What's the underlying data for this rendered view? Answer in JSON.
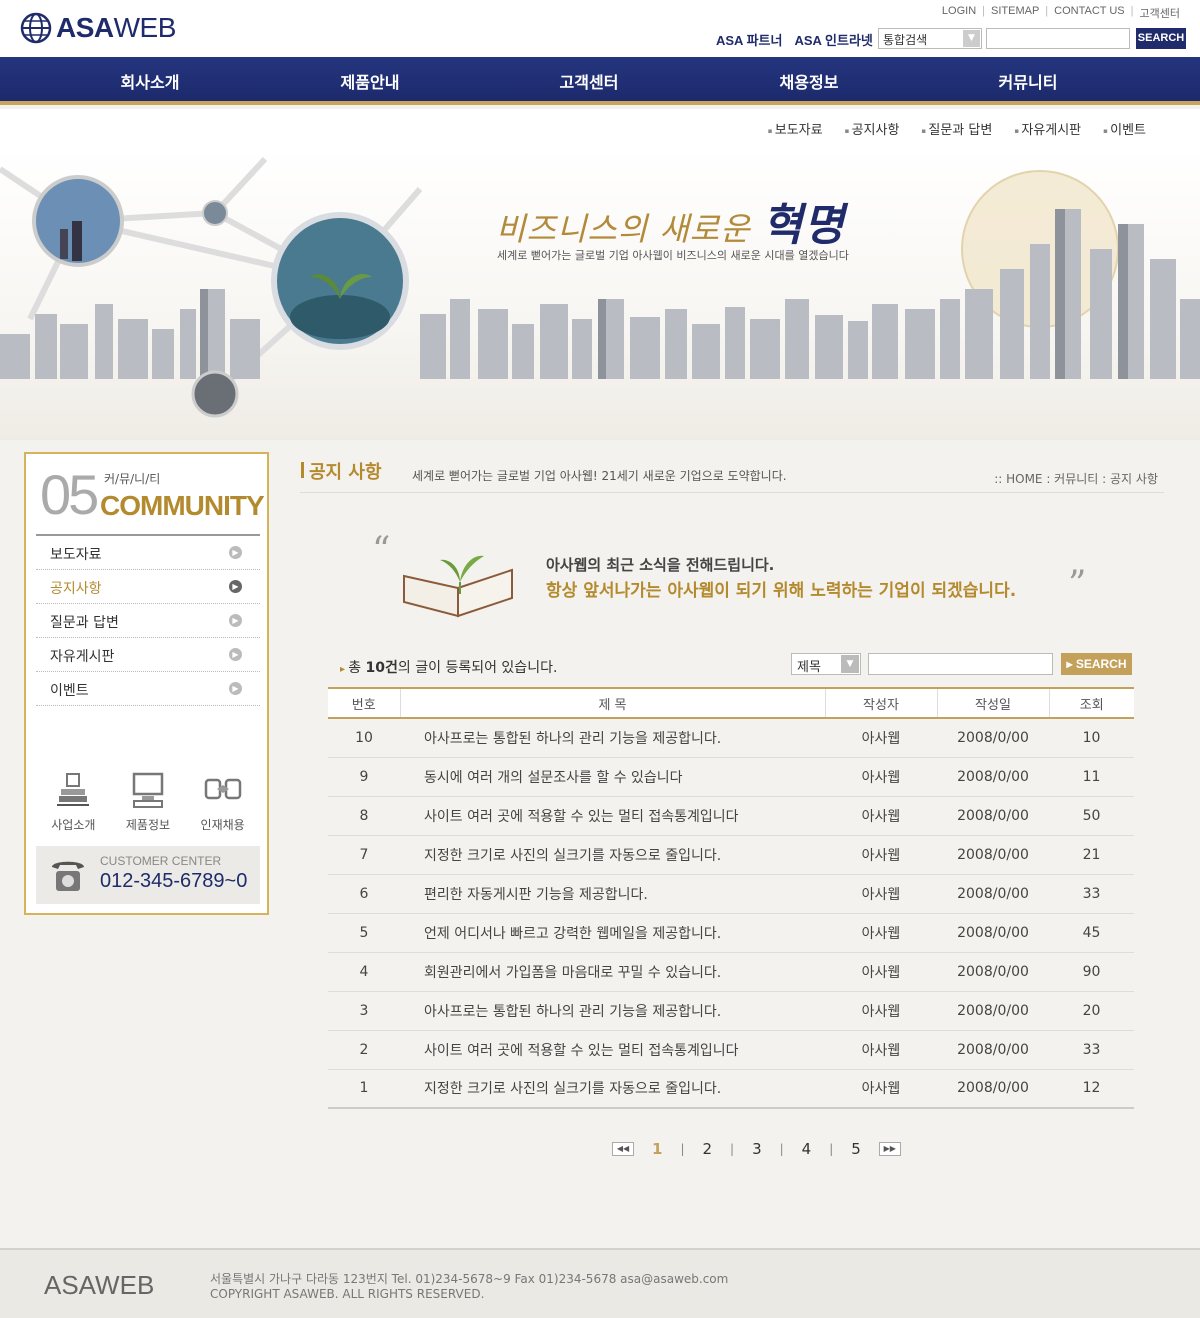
{
  "header": {
    "logo": {
      "bold": "ASA",
      "light": "WEB"
    },
    "toplinks": [
      "LOGIN",
      "SITEMAP",
      "CONTACT US",
      "고객센터"
    ],
    "partners": [
      "ASA 파트너",
      "ASA 인트라넷"
    ],
    "search_scope": "통합검색",
    "search_button": "SEARCH"
  },
  "nav": [
    "회사소개",
    "제품안내",
    "고객센터",
    "채용정보",
    "커뮤니티"
  ],
  "subnav": [
    "보도자료",
    "공지사항",
    "질문과 답변",
    "자유게시판",
    "이벤트"
  ],
  "banner": {
    "title": "비즈니스의 새로운",
    "title_emph": "혁명",
    "subtitle": "세계로 뻗어가는 글로벌 기업 아사웹이 비즈니스의 새로운 시대를 열겠습니다"
  },
  "sidebar": {
    "number": "05",
    "kor": "커/뮤/니/티",
    "eng": "COMMUNITY",
    "menu": [
      {
        "label": "보도자료",
        "active": false
      },
      {
        "label": "공지사항",
        "active": true
      },
      {
        "label": "질문과 답변",
        "active": false
      },
      {
        "label": "자유게시판",
        "active": false
      },
      {
        "label": "이벤트",
        "active": false
      }
    ],
    "quick": [
      "사업소개",
      "제품정보",
      "인재채용"
    ],
    "customer_center": {
      "label": "CUSTOMER CENTER",
      "phone": "012-345-6789~0"
    }
  },
  "content": {
    "title": "공지 사항",
    "desc": "세계로 뻗어가는 글로벌 기업 아사웹! 21세기 새로운 기업으로 도약합니다.",
    "breadcrumb": ":: HOME : 커뮤니티 : 공지 사항",
    "notice_line1": "아사웹의 최근 소식을 전해드립니다.",
    "notice_line2": "항상 앞서나가는 아사웹이 되기 위해 노력하는 기업이 되겠습니다.",
    "count_prefix": "총 ",
    "count_value": "10건",
    "count_suffix": "의 글이 등록되어 있습니다.",
    "search_field": "제목",
    "search_button": "SEARCH"
  },
  "table": {
    "headers": [
      "번호",
      "제 목",
      "작성자",
      "작성일",
      "조회"
    ],
    "rows": [
      {
        "no": "10",
        "subject": "아사프로는 통합된 하나의 관리 기능을 제공합니다.",
        "author": "아사웹",
        "date": "2008/0/00",
        "views": "10"
      },
      {
        "no": "9",
        "subject": "동시에 여러 개의 설문조사를 할 수 있습니다",
        "author": "아사웹",
        "date": "2008/0/00",
        "views": "11"
      },
      {
        "no": "8",
        "subject": "사이트 여러 곳에 적용할 수 있는 멀티 접속통계입니다",
        "author": "아사웹",
        "date": "2008/0/00",
        "views": "50"
      },
      {
        "no": "7",
        "subject": "지정한 크기로 사진의 실크기를 자동으로 줄입니다.",
        "author": "아사웹",
        "date": "2008/0/00",
        "views": "21"
      },
      {
        "no": "6",
        "subject": "편리한 자동게시판 기능을 제공합니다.",
        "author": "아사웹",
        "date": "2008/0/00",
        "views": "33"
      },
      {
        "no": "5",
        "subject": "언제 어디서나 빠르고 강력한 웹메일을 제공합니다.",
        "author": "아사웹",
        "date": "2008/0/00",
        "views": "45"
      },
      {
        "no": "4",
        "subject": "회원관리에서 가입폼을 마음대로 꾸밀 수 있습니다.",
        "author": "아사웹",
        "date": "2008/0/00",
        "views": "90"
      },
      {
        "no": "3",
        "subject": "아사프로는 통합된 하나의 관리 기능을 제공합니다.",
        "author": "아사웹",
        "date": "2008/0/00",
        "views": "20"
      },
      {
        "no": "2",
        "subject": "사이트 여러 곳에 적용할 수 있는 멀티 접속통계입니다",
        "author": "아사웹",
        "date": "2008/0/00",
        "views": "33"
      },
      {
        "no": "1",
        "subject": "지정한 크기로 사진의 실크기를 자동으로 줄입니다.",
        "author": "아사웹",
        "date": "2008/0/00",
        "views": "12"
      }
    ]
  },
  "pager": {
    "pages": [
      "1",
      "2",
      "3",
      "4",
      "5"
    ],
    "current": "1"
  },
  "footer": {
    "logo": "ASAWEB",
    "address": "서울특별시 가나구 다라동 123번지 Tel. 01)234-5678~9 Fax 01)234-5678 asa@asaweb.com",
    "copyright": "COPYRIGHT ASAWEB. ALL RIGHTS RESERVED."
  },
  "colors": {
    "navy": "#1f2b6b",
    "gold": "#b48a2e"
  }
}
